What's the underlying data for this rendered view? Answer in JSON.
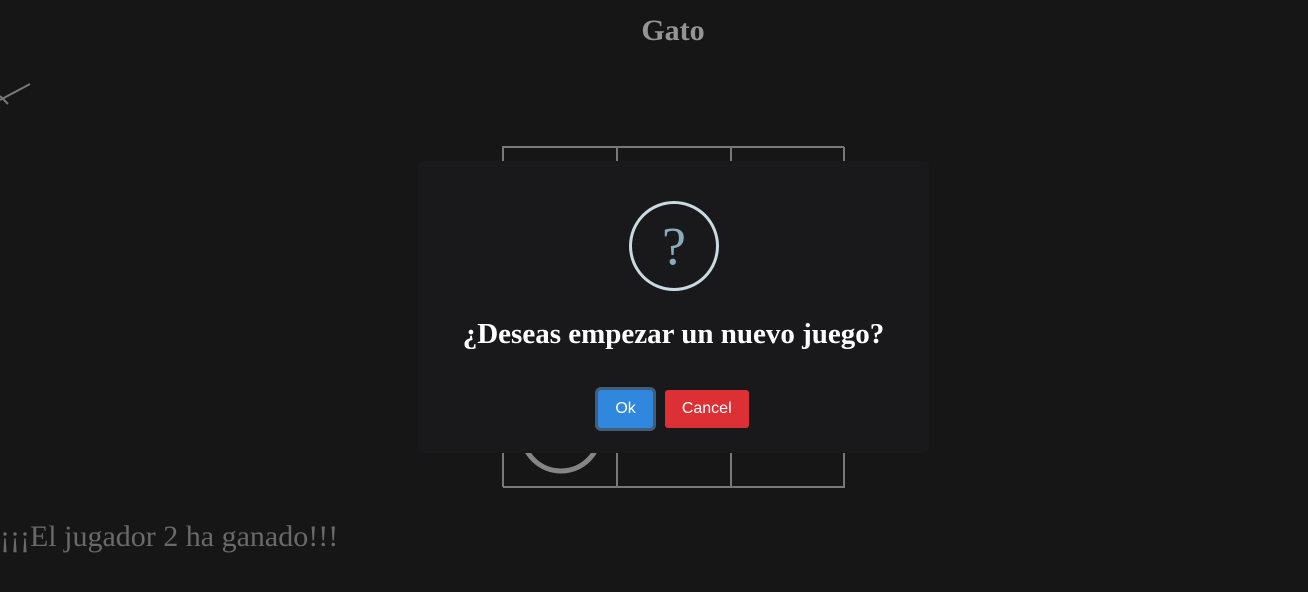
{
  "page": {
    "title": "Gato",
    "status_message": "¡¡¡El jugador 2 ha ganado!!!"
  },
  "board": {
    "cells": [
      "",
      "",
      "",
      "",
      "",
      "",
      "O",
      "",
      ""
    ]
  },
  "dialog": {
    "icon": "question-icon",
    "icon_glyph": "?",
    "title": "¿Deseas empezar un nuevo juego?",
    "confirm_label": "Ok",
    "cancel_label": "Cancel"
  },
  "colors": {
    "confirm": "#2f87de",
    "cancel": "#dd3034",
    "icon_border": "#c9dae1",
    "icon_glyph": "#87adbd"
  }
}
